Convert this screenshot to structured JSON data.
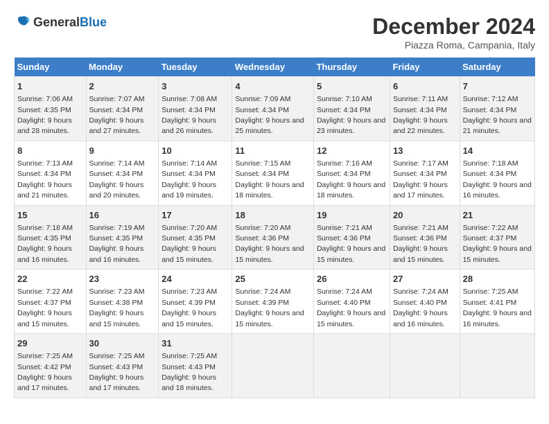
{
  "logo": {
    "general": "General",
    "blue": "Blue"
  },
  "title": "December 2024",
  "subtitle": "Piazza Roma, Campania, Italy",
  "weekdays": [
    "Sunday",
    "Monday",
    "Tuesday",
    "Wednesday",
    "Thursday",
    "Friday",
    "Saturday"
  ],
  "weeks": [
    [
      {
        "day": "1",
        "sunrise": "7:06 AM",
        "sunset": "4:35 PM",
        "daylight": "9 hours and 28 minutes."
      },
      {
        "day": "2",
        "sunrise": "7:07 AM",
        "sunset": "4:34 PM",
        "daylight": "9 hours and 27 minutes."
      },
      {
        "day": "3",
        "sunrise": "7:08 AM",
        "sunset": "4:34 PM",
        "daylight": "9 hours and 26 minutes."
      },
      {
        "day": "4",
        "sunrise": "7:09 AM",
        "sunset": "4:34 PM",
        "daylight": "9 hours and 25 minutes."
      },
      {
        "day": "5",
        "sunrise": "7:10 AM",
        "sunset": "4:34 PM",
        "daylight": "9 hours and 23 minutes."
      },
      {
        "day": "6",
        "sunrise": "7:11 AM",
        "sunset": "4:34 PM",
        "daylight": "9 hours and 22 minutes."
      },
      {
        "day": "7",
        "sunrise": "7:12 AM",
        "sunset": "4:34 PM",
        "daylight": "9 hours and 21 minutes."
      }
    ],
    [
      {
        "day": "8",
        "sunrise": "7:13 AM",
        "sunset": "4:34 PM",
        "daylight": "9 hours and 21 minutes."
      },
      {
        "day": "9",
        "sunrise": "7:14 AM",
        "sunset": "4:34 PM",
        "daylight": "9 hours and 20 minutes."
      },
      {
        "day": "10",
        "sunrise": "7:14 AM",
        "sunset": "4:34 PM",
        "daylight": "9 hours and 19 minutes."
      },
      {
        "day": "11",
        "sunrise": "7:15 AM",
        "sunset": "4:34 PM",
        "daylight": "9 hours and 18 minutes."
      },
      {
        "day": "12",
        "sunrise": "7:16 AM",
        "sunset": "4:34 PM",
        "daylight": "9 hours and 18 minutes."
      },
      {
        "day": "13",
        "sunrise": "7:17 AM",
        "sunset": "4:34 PM",
        "daylight": "9 hours and 17 minutes."
      },
      {
        "day": "14",
        "sunrise": "7:18 AM",
        "sunset": "4:34 PM",
        "daylight": "9 hours and 16 minutes."
      }
    ],
    [
      {
        "day": "15",
        "sunrise": "7:18 AM",
        "sunset": "4:35 PM",
        "daylight": "9 hours and 16 minutes."
      },
      {
        "day": "16",
        "sunrise": "7:19 AM",
        "sunset": "4:35 PM",
        "daylight": "9 hours and 16 minutes."
      },
      {
        "day": "17",
        "sunrise": "7:20 AM",
        "sunset": "4:35 PM",
        "daylight": "9 hours and 15 minutes."
      },
      {
        "day": "18",
        "sunrise": "7:20 AM",
        "sunset": "4:36 PM",
        "daylight": "9 hours and 15 minutes."
      },
      {
        "day": "19",
        "sunrise": "7:21 AM",
        "sunset": "4:36 PM",
        "daylight": "9 hours and 15 minutes."
      },
      {
        "day": "20",
        "sunrise": "7:21 AM",
        "sunset": "4:36 PM",
        "daylight": "9 hours and 15 minutes."
      },
      {
        "day": "21",
        "sunrise": "7:22 AM",
        "sunset": "4:37 PM",
        "daylight": "9 hours and 15 minutes."
      }
    ],
    [
      {
        "day": "22",
        "sunrise": "7:22 AM",
        "sunset": "4:37 PM",
        "daylight": "9 hours and 15 minutes."
      },
      {
        "day": "23",
        "sunrise": "7:23 AM",
        "sunset": "4:38 PM",
        "daylight": "9 hours and 15 minutes."
      },
      {
        "day": "24",
        "sunrise": "7:23 AM",
        "sunset": "4:39 PM",
        "daylight": "9 hours and 15 minutes."
      },
      {
        "day": "25",
        "sunrise": "7:24 AM",
        "sunset": "4:39 PM",
        "daylight": "9 hours and 15 minutes."
      },
      {
        "day": "26",
        "sunrise": "7:24 AM",
        "sunset": "4:40 PM",
        "daylight": "9 hours and 15 minutes."
      },
      {
        "day": "27",
        "sunrise": "7:24 AM",
        "sunset": "4:40 PM",
        "daylight": "9 hours and 16 minutes."
      },
      {
        "day": "28",
        "sunrise": "7:25 AM",
        "sunset": "4:41 PM",
        "daylight": "9 hours and 16 minutes."
      }
    ],
    [
      {
        "day": "29",
        "sunrise": "7:25 AM",
        "sunset": "4:42 PM",
        "daylight": "9 hours and 17 minutes."
      },
      {
        "day": "30",
        "sunrise": "7:25 AM",
        "sunset": "4:43 PM",
        "daylight": "9 hours and 17 minutes."
      },
      {
        "day": "31",
        "sunrise": "7:25 AM",
        "sunset": "4:43 PM",
        "daylight": "9 hours and 18 minutes."
      },
      null,
      null,
      null,
      null
    ]
  ],
  "labels": {
    "sunrise": "Sunrise:",
    "sunset": "Sunset:",
    "daylight": "Daylight:"
  }
}
